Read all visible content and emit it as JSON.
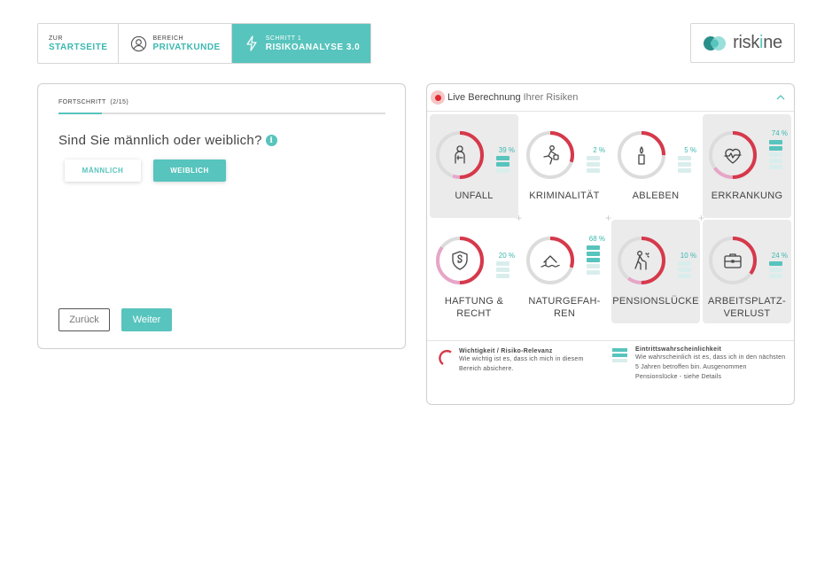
{
  "nav": {
    "home": {
      "small": "ZUR",
      "big": "STARTSEITE"
    },
    "area": {
      "small": "BEREICH",
      "big": "PRIVATKUNDE"
    },
    "step": {
      "small": "SCHRITT 1",
      "big": "RISIKOANALYSE 3.0"
    }
  },
  "logo": {
    "text_a": "risk",
    "text_b": "i",
    "text_c": "ne"
  },
  "progress": {
    "label": "FORTSCHRITT",
    "count": "(2/15)",
    "fraction": 0.133
  },
  "question": {
    "text": "Sind Sie männlich oder weiblich?",
    "info_icon": "i"
  },
  "options": {
    "male": "MÄNNLICH",
    "female": "WEIBLICH",
    "selected": "female"
  },
  "buttons": {
    "back": "Zurück",
    "next": "Weiter"
  },
  "live": {
    "title": "Live Berechnung",
    "subtitle": "Ihrer Risiken"
  },
  "colors": {
    "accent": "#57c4bd",
    "ring_red": "#d6394a",
    "ring_pink": "#e6a6c8",
    "live_dot": "#e0292f"
  },
  "risks": [
    {
      "name": "UNFALL",
      "percent": "39 %",
      "importance": 0.55,
      "bars_on": 2,
      "highlighted": true,
      "icon": "person-injury-icon"
    },
    {
      "name": "KRIMINALITÄT",
      "percent": "2 %",
      "importance": 0.3,
      "bars_on": 0,
      "highlighted": false,
      "icon": "thief-running-icon"
    },
    {
      "name": "ABLEBEN",
      "percent": "5 %",
      "importance": 0.25,
      "bars_on": 0,
      "highlighted": false,
      "icon": "candle-icon"
    },
    {
      "name": "ERKRANKUNG",
      "percent": "74 %",
      "importance": 0.65,
      "bars_on": 2,
      "highlighted": true,
      "icon": "heart-pulse-icon"
    },
    {
      "name": "HAFTUNG & RECHT",
      "percent": "20 %",
      "importance": 0.85,
      "bars_on": 0,
      "highlighted": false,
      "icon": "paragraph-shield-icon"
    },
    {
      "name": "NATURGEFAHREN",
      "percent": "68 %",
      "importance": 0.3,
      "bars_on": 3,
      "highlighted": false,
      "icon": "house-flood-icon"
    },
    {
      "name": "PENSIONSLÜCKE",
      "percent": "10 %",
      "importance": 0.6,
      "bars_on": 0,
      "highlighted": true,
      "icon": "elderly-person-icon"
    },
    {
      "name": "ARBEITSPLATZ-VERLUST",
      "percent": "24 %",
      "importance": 0.35,
      "bars_on": 1,
      "highlighted": true,
      "icon": "briefcase-icon"
    }
  ],
  "legend": {
    "importance_title": "Wichtigkeit / Risiko-Relevanz",
    "importance_text": "Wie wichtig ist es, dass ich mich in diesem Bereich absichere.",
    "probability_title": "Eintrittswahrscheinlichkeit",
    "probability_text": "Wie wahrscheinlich ist es, dass ich in den nächsten 5 Jahren betroffen bin. Ausgenommen Pensionslücke - siehe Details"
  }
}
